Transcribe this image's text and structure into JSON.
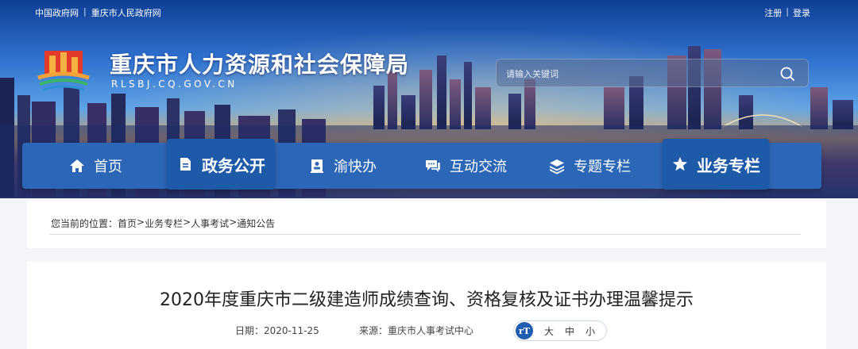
{
  "header": {
    "links": [
      "中国政府网",
      "重庆市人民政府网"
    ],
    "separator": "|",
    "account": {
      "register": "注册",
      "login": "登录"
    },
    "site_title": "重庆市人力资源和社会保障局",
    "site_domain": "RLSBJ.CQ.GOV.CN",
    "search": {
      "placeholder": "请输入关键词"
    }
  },
  "nav": {
    "items": [
      {
        "label": "首页",
        "icon": "home-icon"
      },
      {
        "label": "政务公开",
        "icon": "document-icon",
        "active": true
      },
      {
        "label": "渝快办",
        "icon": "profile-icon"
      },
      {
        "label": "互动交流",
        "icon": "chat-icon"
      },
      {
        "label": "专题专栏",
        "icon": "layers-icon"
      },
      {
        "label": "业务专栏",
        "icon": "star-icon",
        "active": true
      }
    ]
  },
  "breadcrumb": {
    "prefix": "您当前的位置：",
    "items": [
      "首页",
      "业务专栏",
      "人事考试",
      "通知公告"
    ],
    "separator": ">"
  },
  "article": {
    "title": "2020年度重庆市二级建造师成绩查询、资格复核及证书办理温馨提示",
    "date": "日期：2020-11-25",
    "source": "来源：重庆市人事考试中心",
    "font_sizes": [
      "大",
      "中",
      "小"
    ]
  },
  "colors": {
    "nav": "#2c67b7",
    "nav_active": "#1d5aa8",
    "accent": "#1e5db0"
  }
}
